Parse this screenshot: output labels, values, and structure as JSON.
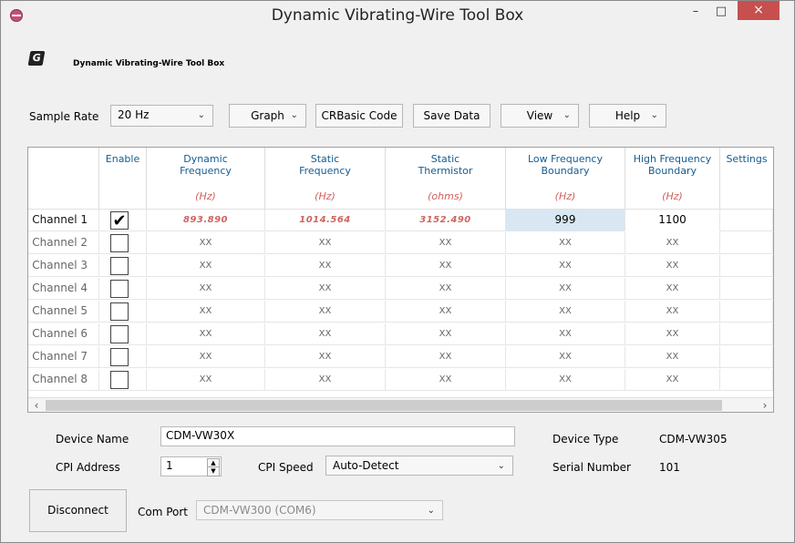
{
  "window": {
    "title": "Dynamic Vibrating-Wire Tool Box",
    "minimize": "–",
    "maximize": "□",
    "close": "×"
  },
  "header": {
    "logo": "G",
    "app_title": "Dynamic Vibrating-Wire Tool Box"
  },
  "toolbar": {
    "sample_rate_label": "Sample Rate",
    "sample_rate_value": "20 Hz",
    "graph": "Graph",
    "crbasic": "CRBasic Code",
    "save": "Save Data",
    "view": "View",
    "help": "Help"
  },
  "table": {
    "columns": [
      {
        "label": "",
        "unit": ""
      },
      {
        "label": "Enable",
        "unit": ""
      },
      {
        "label": "Dynamic\nFrequency",
        "unit": "(Hz)"
      },
      {
        "label": "Static\nFrequency",
        "unit": "(Hz)"
      },
      {
        "label": "Static\nThermistor",
        "unit": "(ohms)"
      },
      {
        "label": "Low Frequency\nBoundary",
        "unit": "(Hz)"
      },
      {
        "label": "High Frequency\nBoundary",
        "unit": "(Hz)"
      },
      {
        "label": "Settings",
        "unit": ""
      }
    ],
    "rows": [
      {
        "name": "Channel 1",
        "enabled": true,
        "dynamic": "893.890",
        "static": "1014.564",
        "thermistor": "3152.490",
        "low": "999",
        "high": "1100",
        "settings": "..."
      },
      {
        "name": "Channel 2",
        "enabled": false,
        "dynamic": "XX",
        "static": "XX",
        "thermistor": "XX",
        "low": "XX",
        "high": "XX",
        "settings": "..."
      },
      {
        "name": "Channel 3",
        "enabled": false,
        "dynamic": "XX",
        "static": "XX",
        "thermistor": "XX",
        "low": "XX",
        "high": "XX",
        "settings": "..."
      },
      {
        "name": "Channel 4",
        "enabled": false,
        "dynamic": "XX",
        "static": "XX",
        "thermistor": "XX",
        "low": "XX",
        "high": "XX",
        "settings": "..."
      },
      {
        "name": "Channel 5",
        "enabled": false,
        "dynamic": "XX",
        "static": "XX",
        "thermistor": "XX",
        "low": "XX",
        "high": "XX",
        "settings": "..."
      },
      {
        "name": "Channel 6",
        "enabled": false,
        "dynamic": "XX",
        "static": "XX",
        "thermistor": "XX",
        "low": "XX",
        "high": "XX",
        "settings": "..."
      },
      {
        "name": "Channel 7",
        "enabled": false,
        "dynamic": "XX",
        "static": "XX",
        "thermistor": "XX",
        "low": "XX",
        "high": "XX",
        "settings": "..."
      },
      {
        "name": "Channel 8",
        "enabled": false,
        "dynamic": "XX",
        "static": "XX",
        "thermistor": "XX",
        "low": "XX",
        "high": "XX",
        "settings": "..."
      }
    ],
    "scroll_left": "‹",
    "scroll_right": "›"
  },
  "device": {
    "name_label": "Device Name",
    "name_value": "CDM-VW30X",
    "cpi_address_label": "CPI Address",
    "cpi_address_value": "1",
    "cpi_speed_label": "CPI Speed",
    "cpi_speed_value": "Auto-Detect",
    "type_label": "Device Type",
    "type_value": "CDM-VW305",
    "serial_label": "Serial Number",
    "serial_value": "101"
  },
  "connection": {
    "disconnect": "Disconnect",
    "com_port_label": "Com Port",
    "com_port_value": "CDM-VW300 (COM6)"
  },
  "icons": {
    "dropdown": "chevron-down-icon",
    "check": "checkmark-icon",
    "spinner": "spinner-icon"
  }
}
